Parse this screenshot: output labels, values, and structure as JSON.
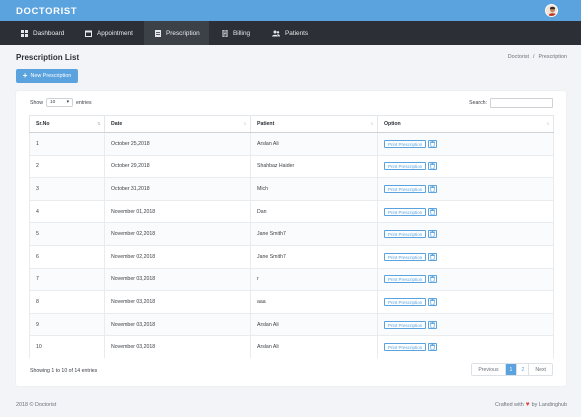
{
  "app": {
    "brand": "DOCTORIST"
  },
  "nav": [
    {
      "label": "Dashboard",
      "icon": "dashboard-icon"
    },
    {
      "label": "Appointment",
      "icon": "calendar-icon"
    },
    {
      "label": "Prescription",
      "icon": "prescription-icon"
    },
    {
      "label": "Billing",
      "icon": "billing-icon"
    },
    {
      "label": "Patients",
      "icon": "users-icon"
    }
  ],
  "page": {
    "title": "Prescription List"
  },
  "breadcrumb": {
    "root": "Doctorist",
    "separator": "/",
    "current": "Prescription"
  },
  "actions": {
    "new_label": "New Prescription"
  },
  "table_controls": {
    "show_prefix": "Show",
    "page_size": "10",
    "show_suffix": "entries",
    "search_label": "Search:",
    "search_value": ""
  },
  "table": {
    "columns": [
      "Sr.No",
      "Date",
      "Patient",
      "Option"
    ],
    "rows": [
      {
        "srno": "1",
        "date": "October 25,2018",
        "patient": "Arslan Ali"
      },
      {
        "srno": "2",
        "date": "October 29,2018",
        "patient": "Shahbaz Haider"
      },
      {
        "srno": "3",
        "date": "October 31,2018",
        "patient": "Mich"
      },
      {
        "srno": "4",
        "date": "November 01,2018",
        "patient": "Dan"
      },
      {
        "srno": "5",
        "date": "November 02,2018",
        "patient": "Jane Smith7"
      },
      {
        "srno": "6",
        "date": "November 02,2018",
        "patient": "Jane Smith7"
      },
      {
        "srno": "7",
        "date": "November 03,2018",
        "patient": "r"
      },
      {
        "srno": "8",
        "date": "November 03,2018",
        "patient": "aaa"
      },
      {
        "srno": "9",
        "date": "November 03,2018",
        "patient": "Arslan Ali"
      },
      {
        "srno": "10",
        "date": "November 03,2018",
        "patient": "Arslan Ali"
      }
    ],
    "print_label": "Print Prescription"
  },
  "pagination": {
    "info": "Showing 1 to 10 of 14 entries",
    "previous": "Previous",
    "pages": [
      "1",
      "2"
    ],
    "current_page": "1",
    "next": "Next"
  },
  "footer": {
    "copyright": "2018 © Doctorist",
    "crafted_prefix": "Crafted with",
    "crafted_suffix": "by Landinghub"
  },
  "colors": {
    "topbar": "#5aa3df",
    "navbar": "#2c3036",
    "accent": "#5aa3df",
    "heart": "#e2413b"
  }
}
